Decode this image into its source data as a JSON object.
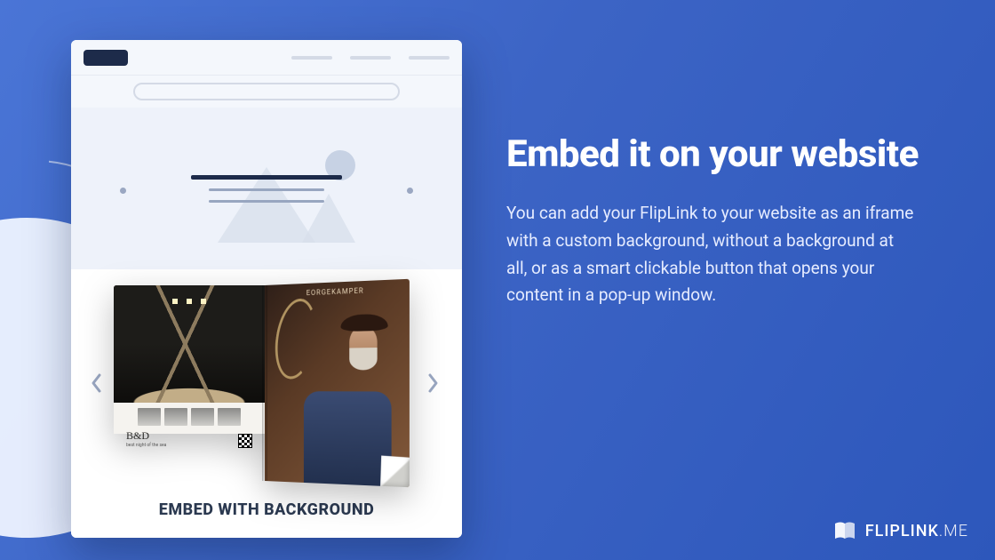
{
  "headline": "Embed it on your website",
  "body": "You can add your FlipLink to your website as an iframe with a custom background, without a background at all, or as a smart clickable button that opens your content in a pop-up window.",
  "mock": {
    "embed_caption": "EMBED WITH BACKGROUND",
    "right_page_caption": "EORGEKAMPER",
    "left_page_script": "B&D",
    "left_page_small": "best night of the sea"
  },
  "brand": {
    "word_main": "FLIPLINK",
    "word_suffix": ".ME"
  }
}
